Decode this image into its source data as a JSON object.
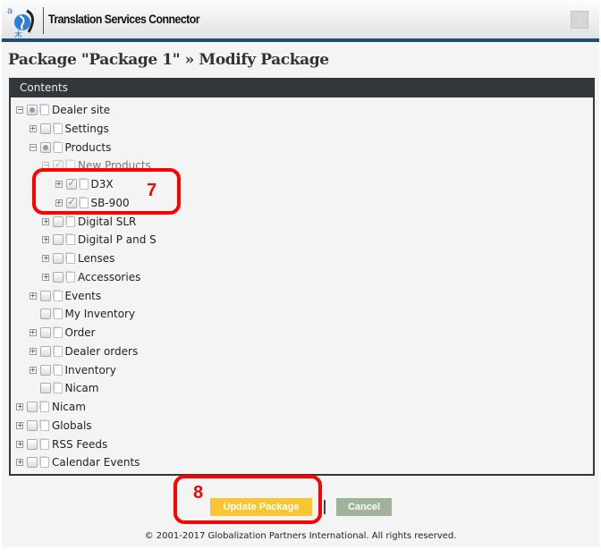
{
  "header": {
    "app_title": "Translation Services Connector",
    "logo": "gpi-globe-logo",
    "settings_icon": "sliders-icon"
  },
  "page_title": "Package \"Package 1\" » Modify Package",
  "panel": {
    "title": "Contents"
  },
  "tree": [
    {
      "label": "Dealer site",
      "level": 0,
      "expander": "minus",
      "check": "partial"
    },
    {
      "label": "Settings",
      "level": 1,
      "expander": "plus",
      "check": "none"
    },
    {
      "label": "Products",
      "level": 1,
      "expander": "minus",
      "check": "partial"
    },
    {
      "label": "New Products",
      "level": 2,
      "expander": "minus",
      "check": "checked",
      "faded": true
    },
    {
      "label": "D3X",
      "level": 3,
      "expander": "plus",
      "check": "checked"
    },
    {
      "label": "SB-900",
      "level": 3,
      "expander": "plus",
      "check": "checked"
    },
    {
      "label": "Digital SLR",
      "level": 2,
      "expander": "plus",
      "check": "none"
    },
    {
      "label": "Digital P and S",
      "level": 2,
      "expander": "plus",
      "check": "none"
    },
    {
      "label": "Lenses",
      "level": 2,
      "expander": "plus",
      "check": "none"
    },
    {
      "label": "Accessories",
      "level": 2,
      "expander": "plus",
      "check": "none"
    },
    {
      "label": "Events",
      "level": 1,
      "expander": "plus",
      "check": "none"
    },
    {
      "label": "My Inventory",
      "level": 1,
      "expander": "",
      "check": "none"
    },
    {
      "label": "Order",
      "level": 1,
      "expander": "plus",
      "check": "none"
    },
    {
      "label": "Dealer orders",
      "level": 1,
      "expander": "plus",
      "check": "none"
    },
    {
      "label": "Inventory",
      "level": 1,
      "expander": "plus",
      "check": "none"
    },
    {
      "label": "Nicam",
      "level": 1,
      "expander": "",
      "check": "none"
    },
    {
      "label": "Nicam",
      "level": 0,
      "expander": "plus",
      "check": "none"
    },
    {
      "label": "Globals",
      "level": 0,
      "expander": "plus",
      "check": "none"
    },
    {
      "label": "RSS Feeds",
      "level": 0,
      "expander": "plus",
      "check": "none"
    },
    {
      "label": "Calendar Events",
      "level": 0,
      "expander": "plus",
      "check": "none"
    }
  ],
  "annotations": {
    "step7": "7",
    "step8": "8",
    "color": "#ff0000"
  },
  "buttons": {
    "update": "Update Package",
    "cancel": "Cancel",
    "update_color": "#f7c632",
    "cancel_color": "#9fb39a"
  },
  "footer": "© 2001-2017 Globalization Partners International. All rights reserved."
}
